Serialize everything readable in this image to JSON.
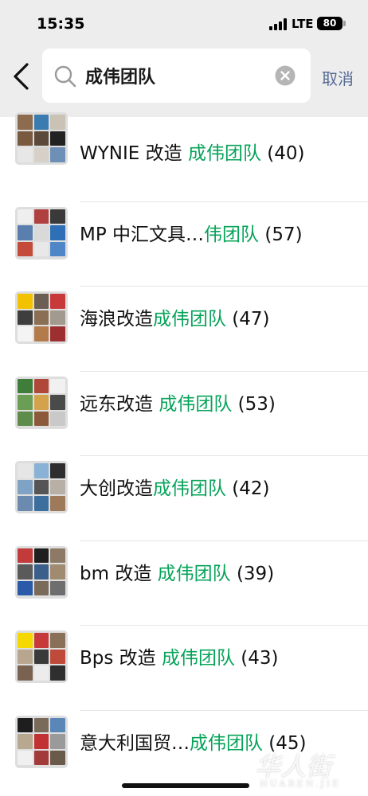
{
  "status_bar": {
    "time": "15:35",
    "network": "LTE",
    "battery": "80"
  },
  "search": {
    "query": "成伟团队",
    "cancel_label": "取消"
  },
  "results": [
    {
      "prefix": "WYNIE 改造 ",
      "highlight": "成伟团队",
      "suffix": " (40)"
    },
    {
      "prefix": "MP 中汇文具…",
      "highlight": "伟团队",
      "suffix": " (57)"
    },
    {
      "prefix": "海浪改造",
      "highlight": "成伟团队",
      "suffix": " (47)"
    },
    {
      "prefix": "远东改造 ",
      "highlight": "成伟团队",
      "suffix": " (53)"
    },
    {
      "prefix": "大创改造",
      "highlight": "成伟团队",
      "suffix": " (42)"
    },
    {
      "prefix": "bm 改造 ",
      "highlight": "成伟团队",
      "suffix": " (39)"
    },
    {
      "prefix": "Bps 改造 ",
      "highlight": "成伟团队",
      "suffix": " (43)"
    },
    {
      "prefix": "意大利国贸…",
      "highlight": "成伟团队",
      "suffix": " (45)"
    }
  ],
  "watermark": {
    "chinese": "华人街",
    "latin": "HUAREN.JIE"
  },
  "colors": {
    "highlight": "#07a35a",
    "cancel": "#576b95",
    "header_bg": "#ededed"
  }
}
